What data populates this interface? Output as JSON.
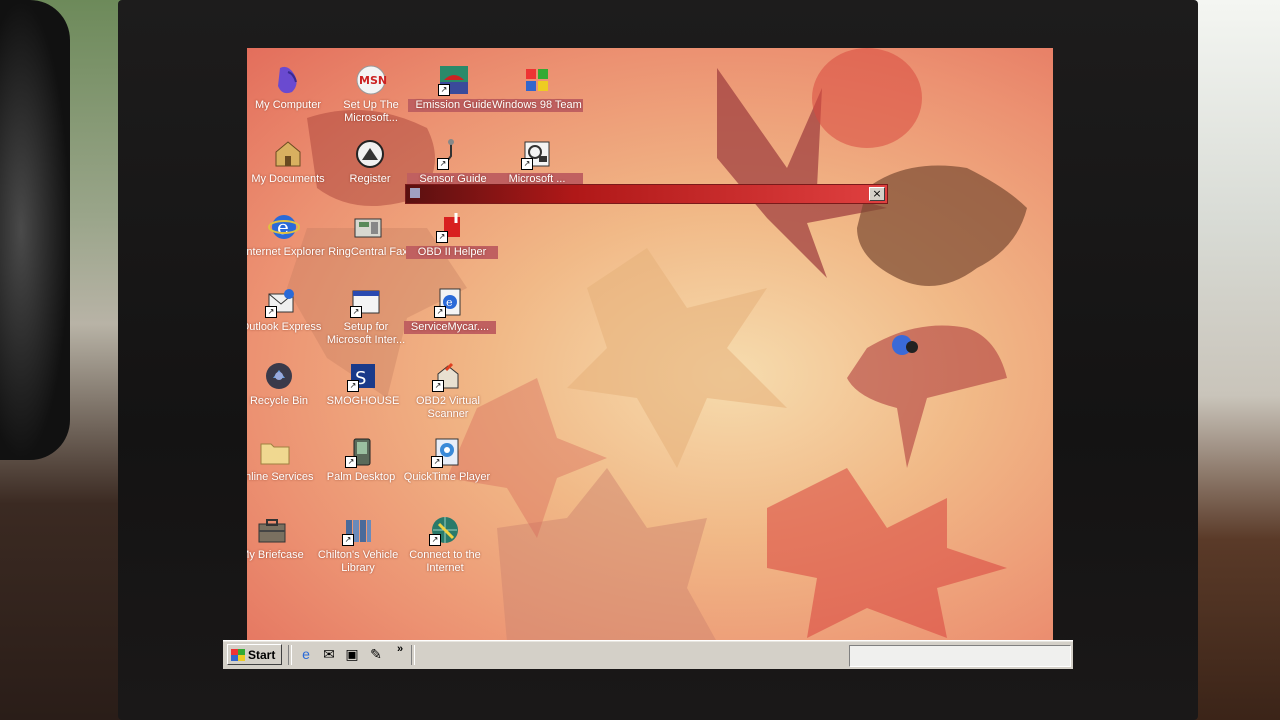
{
  "desktop": {
    "icons": [
      {
        "label": "My Computer"
      },
      {
        "label": "Set Up The Microsoft..."
      },
      {
        "label": "Emission Guide"
      },
      {
        "label": "Windows 98 Team"
      },
      {
        "label": "My Documents"
      },
      {
        "label": "Register"
      },
      {
        "label": "Sensor Guide"
      },
      {
        "label": "Microsoft ..."
      },
      {
        "label": "Internet Explorer"
      },
      {
        "label": "RingCentral Fax"
      },
      {
        "label": "OBD II Helper"
      },
      {
        "label": "Outlook Express"
      },
      {
        "label": "Setup for Microsoft Inter..."
      },
      {
        "label": "ServiceMycar...."
      },
      {
        "label": "Recycle Bin"
      },
      {
        "label": "SMOGHOUSE"
      },
      {
        "label": "OBD2 Virtual Scanner"
      },
      {
        "label": "Online Services"
      },
      {
        "label": "Palm Desktop"
      },
      {
        "label": "QuickTime Player"
      },
      {
        "label": "My Briefcase"
      },
      {
        "label": "Chilton's Vehicle Library"
      },
      {
        "label": "Connect to the Internet"
      }
    ]
  },
  "dialog": {
    "close_label": "×"
  },
  "taskbar": {
    "start_label": "Start",
    "more_label": "»"
  },
  "colors": {
    "wallpaper_center": "#f6dcae",
    "wallpaper_edge": "#e36e5c",
    "taskbar": "#d4d0c8",
    "titlebar_active": "#b01818"
  }
}
